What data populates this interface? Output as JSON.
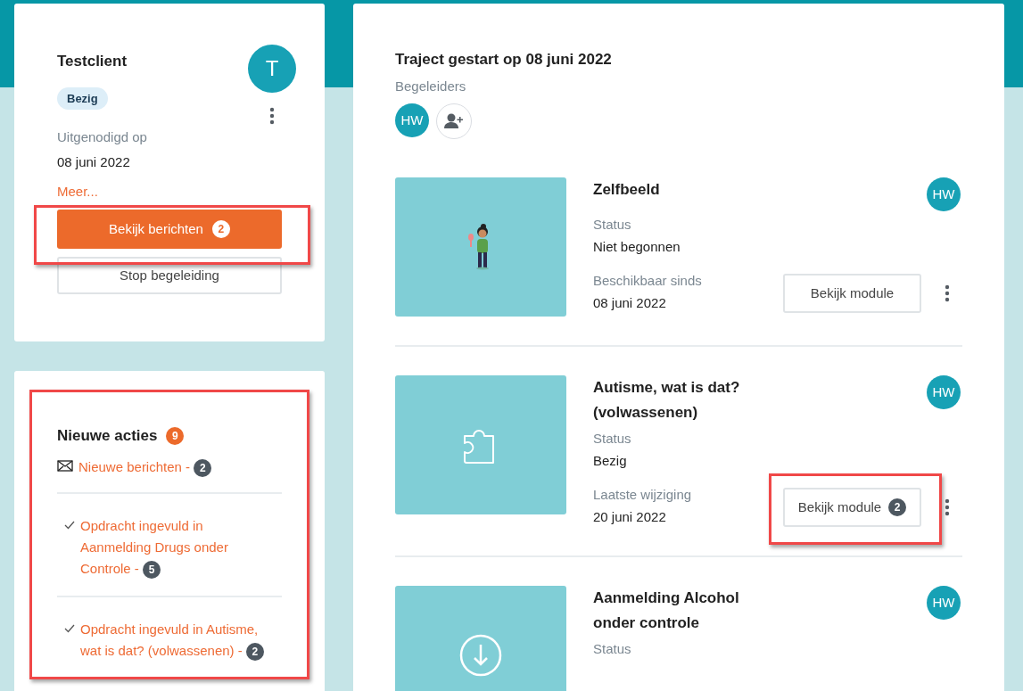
{
  "client": {
    "name": "Testclient",
    "avatar": "T",
    "status": "Bezig",
    "invited_label": "Uitgenodigd op",
    "invited_date": "08 juni 2022",
    "more_link": "Meer...",
    "messages_button": {
      "label": "Bekijk berichten",
      "count": "2",
      "highlighted": true
    },
    "stop_button": "Stop begeleiding"
  },
  "new_actions": {
    "title": "Nieuwe acties",
    "count": "9",
    "highlighted": true,
    "items": [
      {
        "kind": "message",
        "text": "Nieuwe berichten -",
        "count": "2"
      },
      {
        "kind": "check",
        "text": "Opdracht ingevuld in Aanmelding Drugs onder Controle -",
        "count": "5"
      },
      {
        "kind": "check",
        "text": "Opdracht ingevuld in Autisme, wat is dat? (volwassenen) -",
        "count": "2"
      }
    ]
  },
  "traject": {
    "title": "Traject gestart op 08 juni 2022",
    "guides_label": "Begeleiders",
    "guides": [
      "HW"
    ]
  },
  "modules": [
    {
      "kind": "figure",
      "title": "Zelfbeeld",
      "avatar": "HW",
      "status_label": "Status",
      "status": "Niet begonnen",
      "date_label": "Beschikbaar sinds",
      "date": "08 juni 2022",
      "button": {
        "label": "Bekijk module",
        "highlighted": false
      }
    },
    {
      "kind": "puzzle",
      "title": "Autisme, wat is dat? (volwassenen)",
      "avatar": "HW",
      "status_label": "Status",
      "status": "Bezig",
      "date_label": "Laatste wijziging",
      "date": "20 juni 2022",
      "button": {
        "label": "Bekijk module",
        "count": "2",
        "highlighted": true
      }
    },
    {
      "kind": "download",
      "title": "Aanmelding Alcohol onder controle",
      "avatar": "HW",
      "status_label": "Status"
    }
  ]
}
